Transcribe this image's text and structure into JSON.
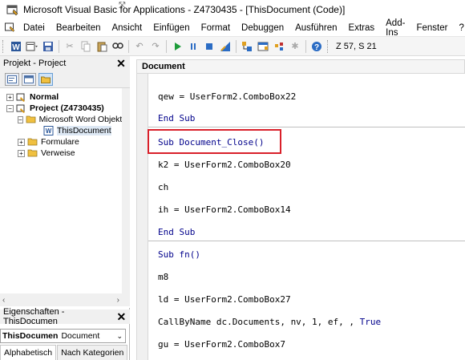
{
  "window": {
    "title": "Microsoft Visual Basic for Applications - Z4730435 - [ThisDocument (Code)]"
  },
  "menu": [
    {
      "label": "Datei"
    },
    {
      "label": "Bearbeiten"
    },
    {
      "label": "Ansicht"
    },
    {
      "label": "Einfügen"
    },
    {
      "label": "Format"
    },
    {
      "label": "Debuggen"
    },
    {
      "label": "Ausführen"
    },
    {
      "label": "Extras"
    },
    {
      "label": "Add-Ins"
    },
    {
      "label": "Fenster"
    },
    {
      "label": "?"
    }
  ],
  "toolbar": {
    "position": "Z 57, S 21"
  },
  "project": {
    "header": "Projekt - Project",
    "tree": [
      {
        "label": "Normal"
      },
      {
        "label": "Project (Z4730435)"
      },
      {
        "label": "Microsoft Word Objekte"
      },
      {
        "label": "ThisDocument"
      },
      {
        "label": "Formulare"
      },
      {
        "label": "Verweise"
      }
    ]
  },
  "properties": {
    "header": "Eigenschaften - ThisDocumen",
    "object": "ThisDocumen",
    "type": "Document",
    "tabs": [
      "Alphabetisch",
      "Nach Kategorien"
    ]
  },
  "code": {
    "object_box": "Document",
    "lines": [
      {
        "text": "qew = UserForm2.ComboBox22"
      },
      {
        "text": "End Sub"
      },
      {
        "text": "Sub Document_Close()"
      },
      {
        "text": "k2 = UserForm2.ComboBox20"
      },
      {
        "text": "ch"
      },
      {
        "text": "ih = UserForm2.ComboBox14"
      },
      {
        "text": "End Sub"
      },
      {
        "text": "Sub fn()"
      },
      {
        "text": "m8"
      },
      {
        "text": "ld = UserForm2.ComboBox27"
      },
      {
        "text": "CallByName dc.Documents, nv, 1, ef, , "
      },
      {
        "text": "True"
      },
      {
        "text": "gu = UserForm2.ComboBox7"
      }
    ]
  },
  "colors": {
    "highlight_border": "#d9202a",
    "keyword": "#00008b"
  }
}
